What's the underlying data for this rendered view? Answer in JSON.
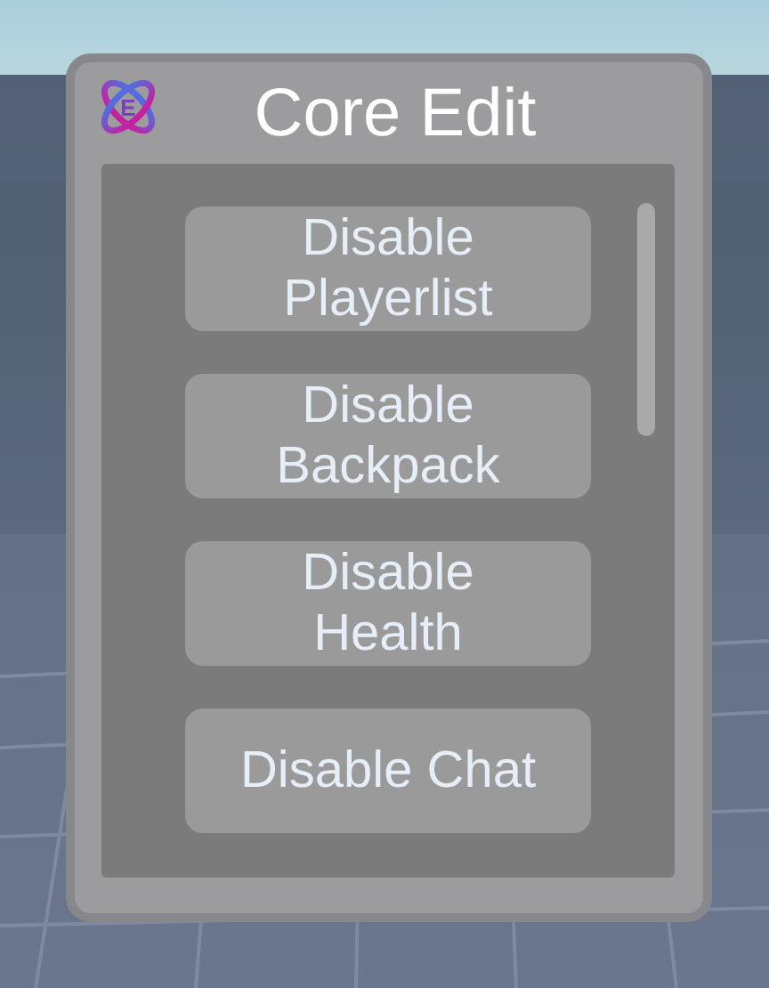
{
  "window": {
    "title": "Core Edit",
    "logo_letter": "E"
  },
  "buttons": [
    {
      "label": "Disable Playerlist"
    },
    {
      "label": "Disable Backpack"
    },
    {
      "label": "Disable Health"
    },
    {
      "label": "Disable Chat"
    }
  ]
}
